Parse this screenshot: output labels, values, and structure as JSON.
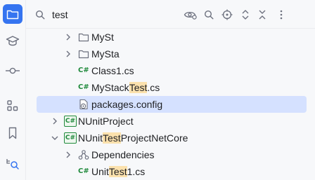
{
  "sidebar": {
    "items": [
      {
        "name": "project",
        "icon": "folder-icon",
        "active": true
      },
      {
        "name": "learn",
        "icon": "graduation-cap-icon",
        "active": false
      },
      {
        "name": "commit",
        "icon": "commit-icon",
        "active": false
      },
      {
        "name": "structure",
        "icon": "structure-icon",
        "active": false
      },
      {
        "name": "bookmarks",
        "icon": "bookmark-icon",
        "active": false
      },
      {
        "name": "find",
        "icon": "find-in-tree-icon",
        "active": false
      }
    ]
  },
  "search": {
    "value": "test"
  },
  "toolbar": {
    "icons": [
      "eye-settings-icon",
      "search-icon",
      "locate-icon",
      "expand-all-icon",
      "collapse-all-icon",
      "more-icon"
    ]
  },
  "tree": {
    "rows": [
      {
        "label_parts": [
          "MySt"
        ],
        "highlight_index": -1,
        "type": "folder",
        "expanded": false,
        "icon": "folder-icon"
      },
      {
        "label_parts": [
          "MySta"
        ],
        "highlight_index": -1,
        "type": "folder",
        "expanded": false,
        "icon": "folder-icon"
      },
      {
        "label_parts": [
          "Class1.cs"
        ],
        "highlight_index": -1,
        "type": "csfile",
        "icon": "csharp-file-icon",
        "badge": "C#"
      },
      {
        "label_parts": [
          "MyStack",
          "Test",
          ".cs"
        ],
        "highlight_index": 1,
        "type": "csfile",
        "icon": "csharp-file-icon",
        "badge": "C#"
      },
      {
        "label_parts": [
          "packages.config"
        ],
        "highlight_index": -1,
        "type": "config",
        "icon": "config-file-icon",
        "selected": true
      },
      {
        "label_parts": [
          "NUnitProject"
        ],
        "highlight_index": -1,
        "type": "project",
        "expanded": false,
        "icon": "csharp-project-icon",
        "badge": "C#"
      },
      {
        "label_parts": [
          "NUnit",
          "Test",
          "ProjectNetCore"
        ],
        "highlight_index": 1,
        "type": "project",
        "expanded": true,
        "icon": "csharp-project-icon",
        "badge": "C#"
      },
      {
        "label_parts": [
          "Dependencies"
        ],
        "highlight_index": -1,
        "type": "dependencies",
        "expanded": false,
        "icon": "dependencies-icon"
      },
      {
        "label_parts": [
          "Unit",
          "Test",
          "1.cs"
        ],
        "highlight_index": 1,
        "type": "csfile",
        "icon": "csharp-file-icon",
        "badge": "C#"
      }
    ]
  }
}
